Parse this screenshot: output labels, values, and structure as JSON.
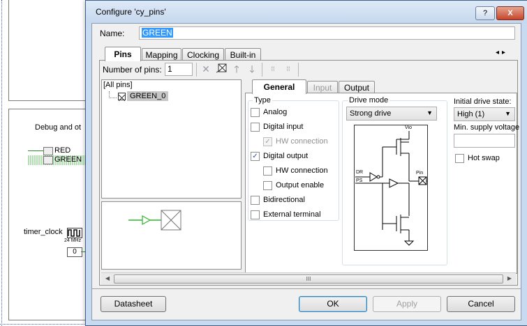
{
  "dialog": {
    "title": "Configure 'cy_pins'",
    "help_button": "?",
    "close_button": "X",
    "name_label": "Name:",
    "name_value": "GREEN"
  },
  "tabs": {
    "main": [
      "Pins",
      "Mapping",
      "Clocking",
      "Built-in"
    ],
    "sub": [
      "General",
      "Input",
      "Output"
    ]
  },
  "toolbar": {
    "num_pins_label": "Number of pins:",
    "num_pins_value": "1"
  },
  "tree": {
    "root": "[All pins]",
    "item": "GREEN_0"
  },
  "general": {
    "type_label": "Type",
    "analog": "Analog",
    "digital_input": "Digital input",
    "hw_connection_in": "HW connection",
    "digital_output": "Digital output",
    "hw_connection_out": "HW connection",
    "output_enable": "Output enable",
    "bidirectional": "Bidirectional",
    "external_terminal": "External terminal",
    "drive_mode_label": "Drive mode",
    "drive_mode_value": "Strong drive",
    "initial_drive_label": "Initial drive state:",
    "initial_drive_value": "High (1)",
    "min_supply_label": "Min. supply voltage",
    "min_supply_value": "",
    "hot_swap": "Hot swap",
    "checked": {
      "analog": false,
      "digital_input": false,
      "hw_connection_in": true,
      "digital_output": true,
      "hw_connection_out": false,
      "output_enable": false,
      "bidirectional": false,
      "external_terminal": false,
      "hot_swap": false
    }
  },
  "schematic": {
    "vio": "Vio",
    "dr": "DR",
    "ps": "PS",
    "pin": "Pin"
  },
  "scrollbar": {
    "grip": "III"
  },
  "buttons": {
    "datasheet": "Datasheet",
    "ok": "OK",
    "apply": "Apply",
    "cancel": "Cancel"
  },
  "background": {
    "section_title": "Debug and ot",
    "red_label": "RED",
    "green_label": "GREEN",
    "timer_label": "timer_clock",
    "clock_freq": "24 MHz",
    "const_value": "0"
  }
}
